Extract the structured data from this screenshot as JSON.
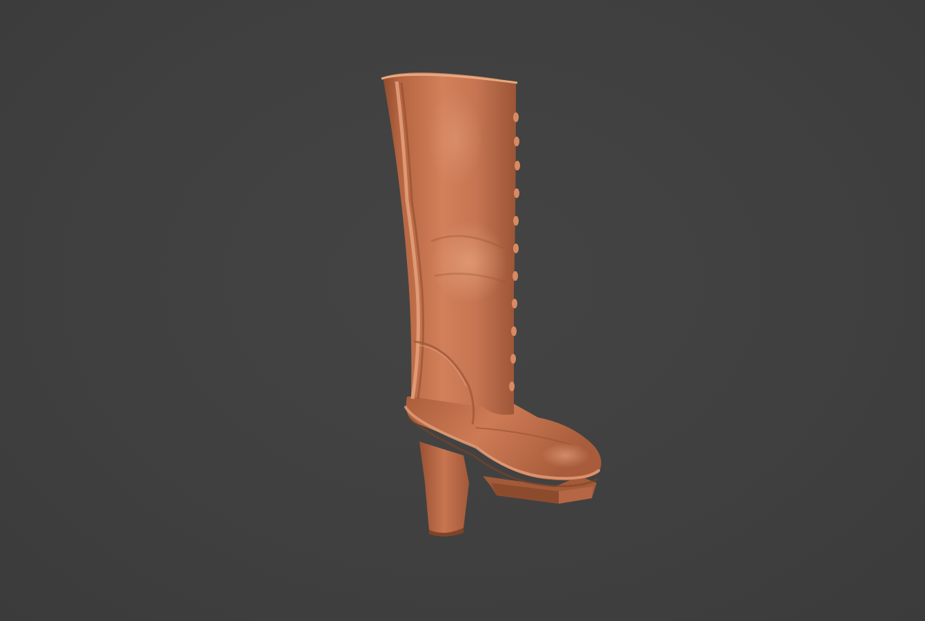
{
  "viewport": {
    "background_color": "#404040"
  },
  "model": {
    "subject": "boot-model",
    "material_color": "#c8714a",
    "shadow_color": "#8a4a2c",
    "highlight_color": "#e09a72"
  }
}
